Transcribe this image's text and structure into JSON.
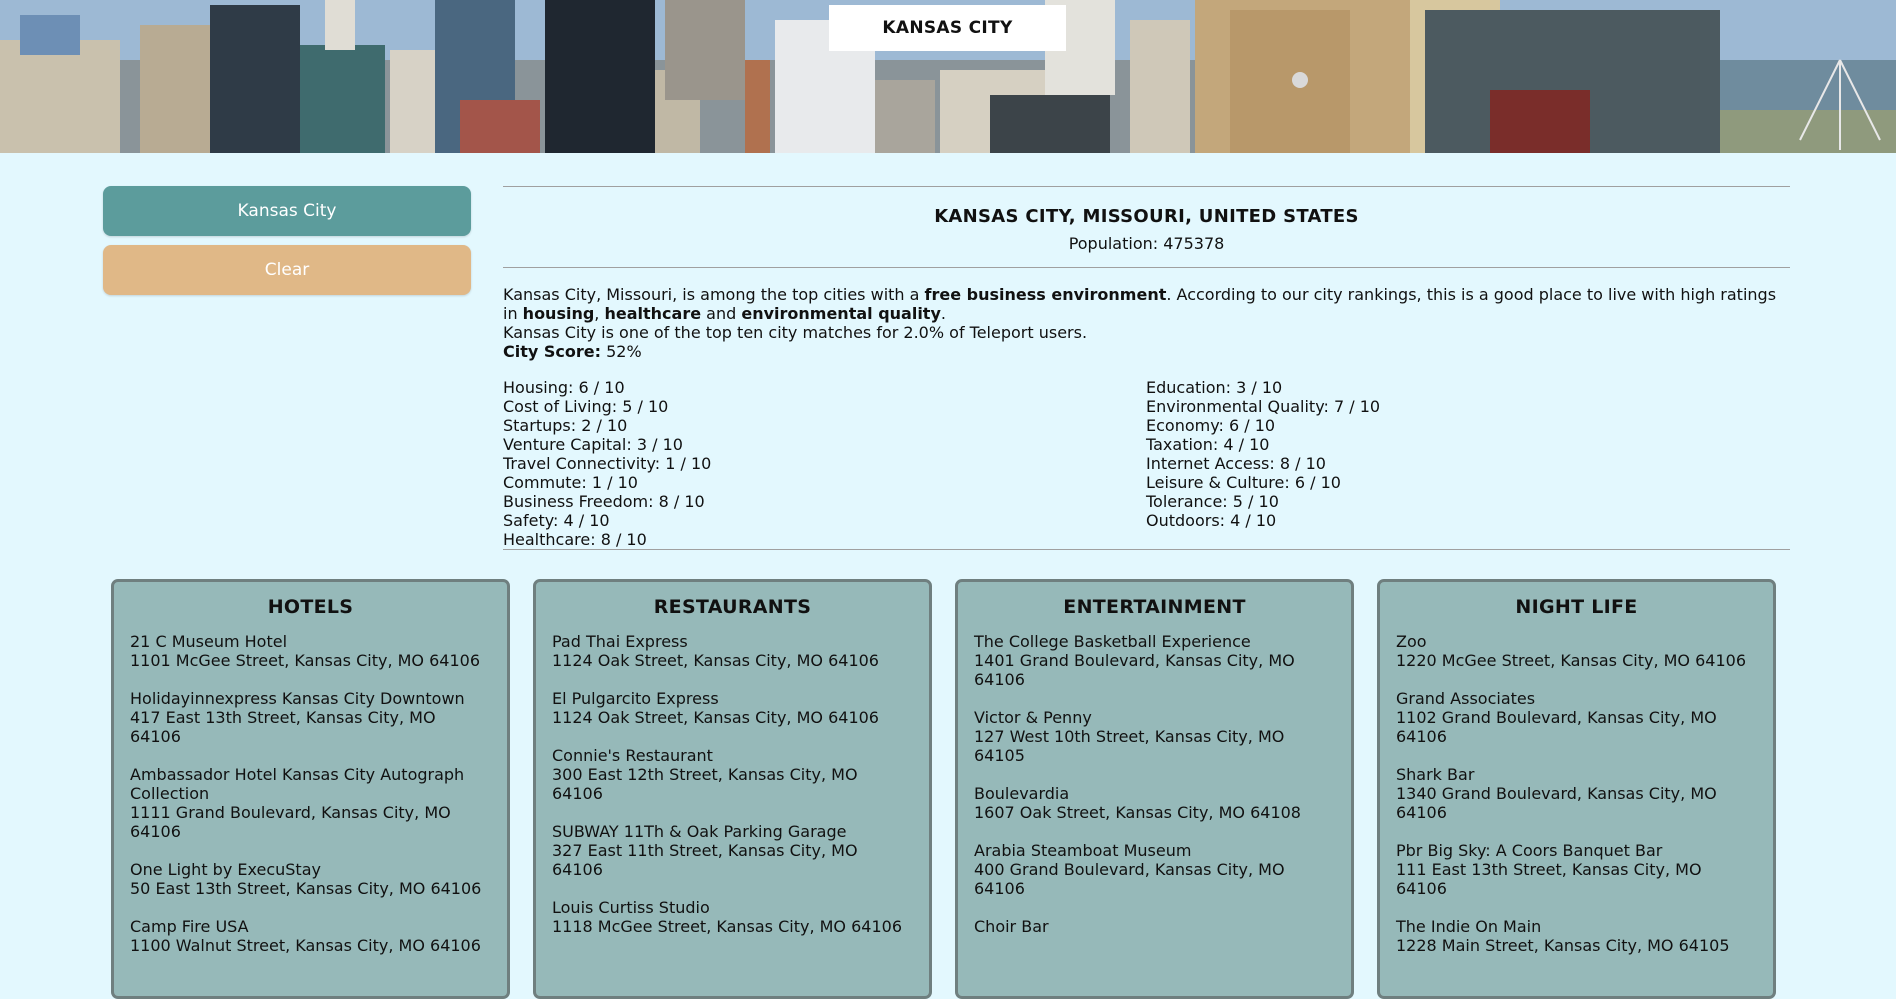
{
  "banner": {
    "title": "KANSAS CITY"
  },
  "sidebar": {
    "city_button_label": "Kansas City",
    "clear_button_label": "Clear"
  },
  "city": {
    "heading": "KANSAS CITY, MISSOURI, UNITED STATES",
    "population": "Population: 475378",
    "summary": {
      "part1": "Kansas City, Missouri, is among the top cities with a ",
      "bold1": "free business environment",
      "part2": ". According to our city rankings, this is a good place to live with high ratings in ",
      "bold2": "housing",
      "part3": ", ",
      "bold3": "healthcare",
      "part4": " and ",
      "bold4": "environmental quality",
      "part5": ".",
      "line2": "Kansas City is one of the top ten city matches for 2.0% of Teleport users.",
      "score_label": "City Score:",
      "score_value": " 52%"
    },
    "scores_left": [
      "Housing: 6 / 10",
      "Cost of Living: 5 / 10",
      "Startups: 2 / 10",
      "Venture Capital: 3 / 10",
      "Travel Connectivity: 1 / 10",
      "Commute: 1 / 10",
      "Business Freedom: 8 / 10",
      "Safety: 4 / 10",
      "Healthcare: 8 / 10"
    ],
    "scores_right": [
      "Education: 3 / 10",
      "Environmental Quality: 7 / 10",
      "Economy: 6 / 10",
      "Taxation: 4 / 10",
      "Internet Access: 8 / 10",
      "Leisure & Culture: 6 / 10",
      "Tolerance: 5 / 10",
      "Outdoors: 4 / 10"
    ]
  },
  "cards": [
    {
      "title": "HOTELS",
      "entries": [
        {
          "name": "21 C Museum Hotel",
          "address": "1101 McGee Street, Kansas City, MO 64106"
        },
        {
          "name": "Holidayinnexpress Kansas City Downtown",
          "address": "417 East 13th Street, Kansas City, MO 64106"
        },
        {
          "name": "Ambassador Hotel Kansas City Autograph Collection",
          "address": "1111 Grand Boulevard, Kansas City, MO 64106"
        },
        {
          "name": "One Light by ExecuStay",
          "address": "50 East 13th Street, Kansas City, MO 64106"
        },
        {
          "name": "Camp Fire USA",
          "address": "1100 Walnut Street, Kansas City, MO 64106"
        }
      ]
    },
    {
      "title": "RESTAURANTS",
      "entries": [
        {
          "name": "Pad Thai Express",
          "address": "1124 Oak Street, Kansas City, MO 64106"
        },
        {
          "name": "El Pulgarcito Express",
          "address": "1124 Oak Street, Kansas City, MO 64106"
        },
        {
          "name": "Connie's Restaurant",
          "address": "300 East 12th Street, Kansas City, MO 64106"
        },
        {
          "name": "SUBWAY 11Th & Oak Parking Garage",
          "address": "327 East 11th Street, Kansas City, MO 64106"
        },
        {
          "name": "Louis Curtiss Studio",
          "address": "1118 McGee Street, Kansas City, MO 64106"
        }
      ]
    },
    {
      "title": "ENTERTAINMENT",
      "entries": [
        {
          "name": "The College Basketball Experience",
          "address": "1401 Grand Boulevard, Kansas City, MO 64106"
        },
        {
          "name": "Victor & Penny",
          "address": "127 West 10th Street, Kansas City, MO 64105"
        },
        {
          "name": "Boulevardia",
          "address": "1607 Oak Street, Kansas City, MO 64108"
        },
        {
          "name": "Arabia Steamboat Museum",
          "address": "400 Grand Boulevard, Kansas City, MO 64106"
        },
        {
          "name": "Choir Bar",
          "address": ""
        }
      ]
    },
    {
      "title": "NIGHT LIFE",
      "entries": [
        {
          "name": "Zoo",
          "address": "1220 McGee Street, Kansas City, MO 64106"
        },
        {
          "name": "Grand Associates",
          "address": "1102 Grand Boulevard, Kansas City, MO 64106"
        },
        {
          "name": "Shark Bar",
          "address": "1340 Grand Boulevard, Kansas City, MO 64106"
        },
        {
          "name": "Pbr Big Sky: A Coors Banquet Bar",
          "address": "111 East 13th Street, Kansas City, MO 64106"
        },
        {
          "name": "The Indie On Main",
          "address": "1228 Main Street, Kansas City, MO 64105"
        }
      ]
    }
  ]
}
